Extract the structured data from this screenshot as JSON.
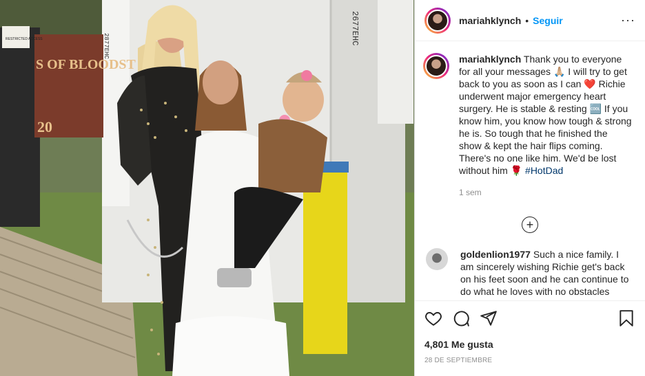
{
  "photo": {
    "signs": {
      "restricted_access": "RESTRICTED ACCESS",
      "banner": "S OF BLOODST",
      "banner_year": "20",
      "booth_code_left": "2877EHC",
      "booth_code_right": "2677EHC"
    }
  },
  "header": {
    "username": "mariahklynch",
    "separator": "•",
    "follow_label": "Seguir",
    "more_label": "···"
  },
  "caption": {
    "username": "mariahklynch",
    "text_part1": "Thank you to everyone for all your messages 🙏🏼 I will try to get back to you as soon as I can ❤️ Richie underwent major emergency heart surgery. He is stable & resting 🆒 If you know him, you know how tough & strong he is. So tough that he finished the show & kept the hair flips coming. There's no one like him. We'd be lost without him 🌹 ",
    "hashtag": "#HotDad",
    "time": "1 sem"
  },
  "load_more": {
    "icon": "plus-circle-icon",
    "label": "+"
  },
  "comment": {
    "username": "goldenlion1977",
    "text": "Such a nice family. I am sincerely wishing Richie get's back on his feet soon and he can continue to do what he loves with no obstacles"
  },
  "actions": {
    "icons": [
      "heart-icon",
      "comment-icon",
      "share-icon",
      "bookmark-icon"
    ],
    "likes": "4,801 Me gusta",
    "date": "28 DE SEPTIEMBRE"
  }
}
